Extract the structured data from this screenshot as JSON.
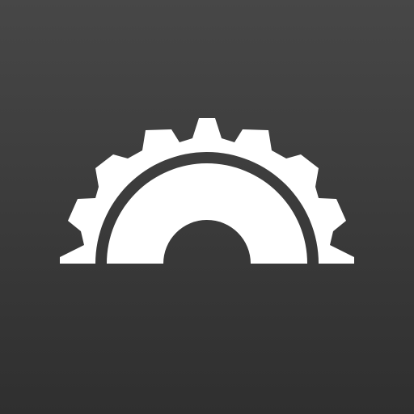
{
  "icon": {
    "name": "half-gear-icon",
    "background_top": "#474747",
    "background_bottom": "#2f2f2f",
    "glyph_color": "#ffffff"
  }
}
